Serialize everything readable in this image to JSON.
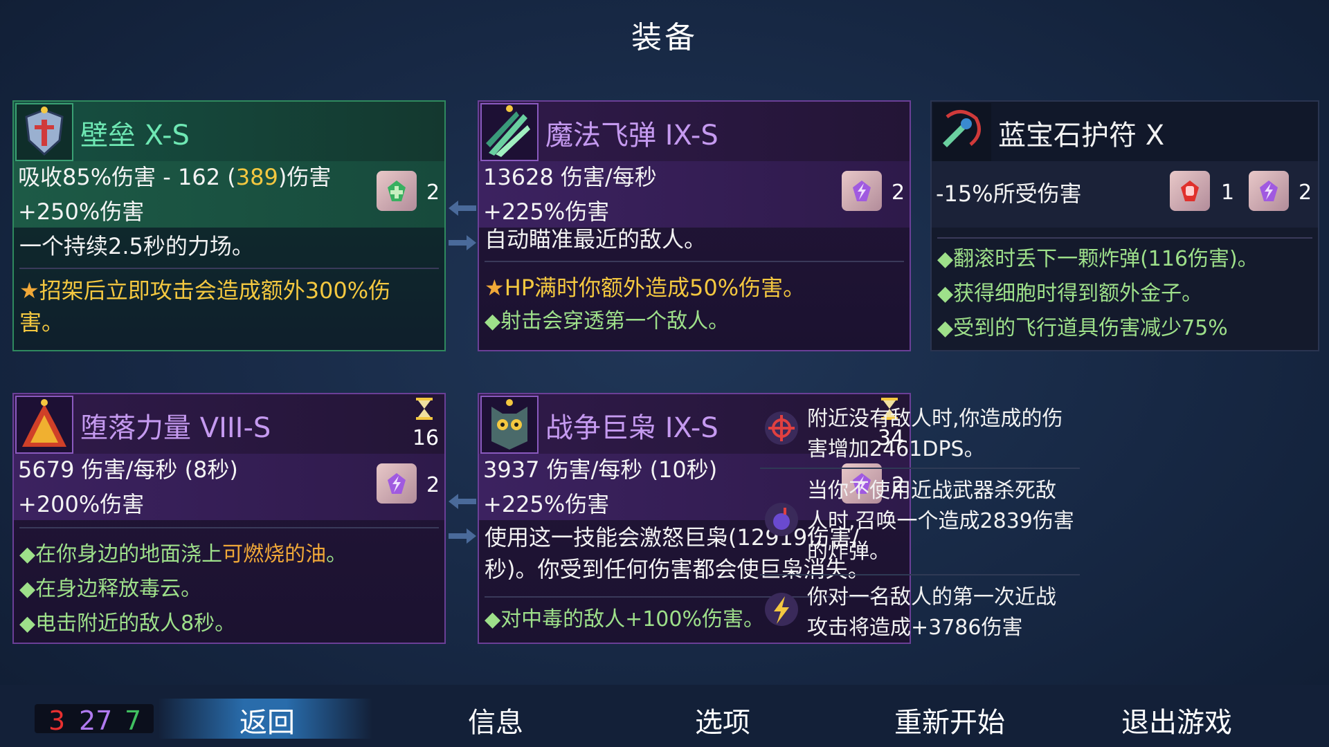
{
  "title": "装备",
  "cards": [
    {
      "name": "壁垒 X-S",
      "line1": {
        "pre": "吸收85%伤害 - 162 (",
        "gold": "389",
        "post": ")伤害"
      },
      "line2": "+250%伤害",
      "desc": "一个持续2.5秒的力场。",
      "perk": "招架后立即攻击会造成额外300%伤害。",
      "scrolls": [
        {
          "type": "survival",
          "count": "2"
        }
      ]
    },
    {
      "name": "魔法飞弹 IX-S",
      "line1": "13628 伤害/每秒",
      "line2": "+225%伤害",
      "desc": "自动瞄准最近的敌人。",
      "perk": "HP满时你额外造成50%伤害。",
      "bullets": [
        "射击会穿透第一个敌人。"
      ],
      "scrolls": [
        {
          "type": "tactics",
          "count": "2"
        }
      ]
    },
    {
      "name": "蓝宝石护符 X",
      "line1": "-15%所受伤害",
      "scrolls": [
        {
          "type": "brutality",
          "count": "1"
        },
        {
          "type": "tactics",
          "count": "2"
        }
      ],
      "bullets": [
        "翻滚时丢下一颗炸弹(116伤害)。",
        "获得细胞时得到额外金子。",
        "受到的飞行道具伤害减少75%"
      ]
    },
    {
      "name": "堕落力量 VIII-S",
      "timer": "16",
      "line1": "5679 伤害/每秒 (8秒)",
      "line2": "+200%伤害",
      "bullets_rich": [
        {
          "pre": "在你身边的地面浇上",
          "hl": "可燃烧的油",
          "post": "。"
        },
        {
          "pre": "在身边释放毒云。",
          "hl": "",
          "post": ""
        },
        {
          "pre": "电击附近的敌人8秒。",
          "hl": "",
          "post": ""
        }
      ],
      "scrolls": [
        {
          "type": "tactics",
          "count": "2"
        }
      ]
    },
    {
      "name": "战争巨枭 IX-S",
      "timer": "34",
      "line1": "3937 伤害/每秒 (10秒)",
      "line2": "+225%伤害",
      "desc": "使用这一技能会激怒巨枭(12919伤害/秒)。你受到任何伤害都会使巨枭消失。",
      "bullets": [
        "对中毒的敌人+100%伤害。"
      ],
      "scrolls": [
        {
          "type": "tactics",
          "count": "2"
        }
      ]
    }
  ],
  "mutations": [
    {
      "icon": "crosshair-icon",
      "text": "附近没有敌人时,你造成的伤害增加2461DPS。"
    },
    {
      "icon": "bomb-icon",
      "text": "当你不使用近战武器杀死敌人时,召唤一个造成2839伤害的炸弹。"
    },
    {
      "icon": "lightning-icon",
      "text": "你对一名敌人的第一次近战攻击将造成+3786伤害"
    }
  ],
  "counter": {
    "red": "3",
    "purple": "27",
    "green": "7"
  },
  "nav": {
    "back": "返回",
    "info": "信息",
    "options": "选项",
    "restart": "重新开始",
    "quit": "退出游戏"
  },
  "colors": {
    "brutality": "#e0302c",
    "tactics": "#a05ae0",
    "survival": "#38b060",
    "gold": "#f4c840"
  }
}
